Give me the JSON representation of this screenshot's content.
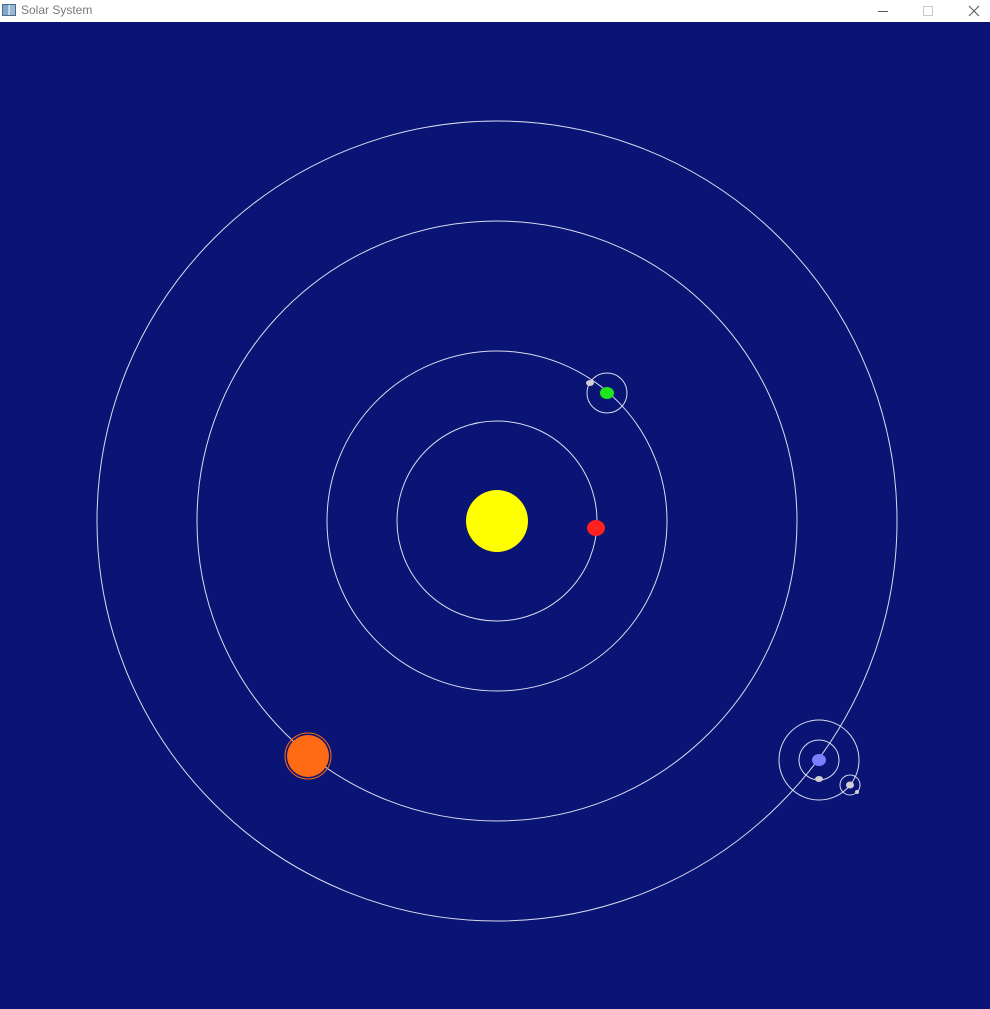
{
  "window": {
    "title": "Solar System",
    "buttons": {
      "minimize_icon": "minimize-icon",
      "maximize_icon": "maximize-icon",
      "close_icon": "close-icon"
    }
  },
  "scene": {
    "background_color": "#0a1474",
    "orbit_color": "#d9dcef",
    "sun": {
      "color": "#ffff00"
    },
    "planets": [
      {
        "id": "red-planet",
        "color": "#ff2020"
      },
      {
        "id": "green-planet",
        "color": "#1ee51e",
        "moons": [
          {
            "color": "#d0d0d0"
          }
        ]
      },
      {
        "id": "orange-planet",
        "color": "#ff6a14"
      },
      {
        "id": "blue-planet",
        "color": "#7a80ff",
        "moons": [
          {
            "color": "#d0d0d0"
          },
          {
            "color": "#d0d0d0",
            "moons": [
              {
                "color": "#d0d0d0"
              }
            ]
          }
        ]
      }
    ]
  }
}
